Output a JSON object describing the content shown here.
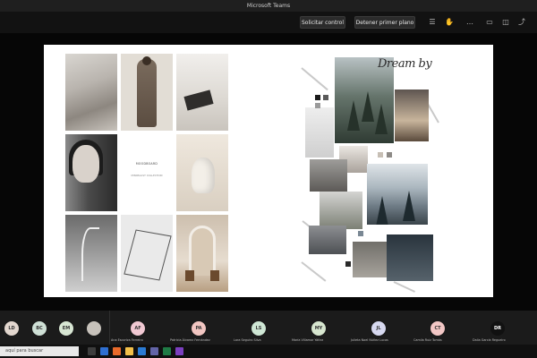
{
  "window": {
    "title": "Microsoft Teams"
  },
  "toolbar": {
    "request_control_label": "Solicitar control",
    "stop_presenting_label": "Detener primer plano"
  },
  "moodboard": {
    "left_brand_title": "MOODBOARD",
    "left_brand_sub": "MINIMALIST COLLECTION",
    "right_script_title": "Dream by"
  },
  "participants": [
    {
      "initials": "LD",
      "color": "#e3d7cf"
    },
    {
      "initials": "BC",
      "color": "#cfe0d6"
    },
    {
      "initials": "EM",
      "color": "#d8e6d3"
    },
    {
      "initials": "",
      "color": "#c7c2bb"
    }
  ],
  "video_tiles": [
    {
      "initials": "AF",
      "name": "Ana Escoriza Ferreiro",
      "color": "#f1c9d3"
    },
    {
      "initials": "PA",
      "name": "Patricia Álvarez Fernández",
      "color": "#f2c6c2"
    },
    {
      "initials": "LS",
      "name": "Lara Seguiro Silva",
      "color": "#cfe7d5"
    },
    {
      "initials": "MY",
      "name": "María Villamor Yáñez",
      "color": "#d7e6cf"
    },
    {
      "initials": "JL",
      "name": "Julieta Noel Núñez Lucas",
      "color": "#d7d9f0"
    },
    {
      "initials": "CT",
      "name": "Camila Ruiz Tomás",
      "color": "#f3c8c6"
    },
    {
      "initials": "DR",
      "name": "Dalia García Regueiro",
      "color": "#111111"
    }
  ],
  "taskbar": {
    "search_placeholder": "aquí para buscar"
  }
}
